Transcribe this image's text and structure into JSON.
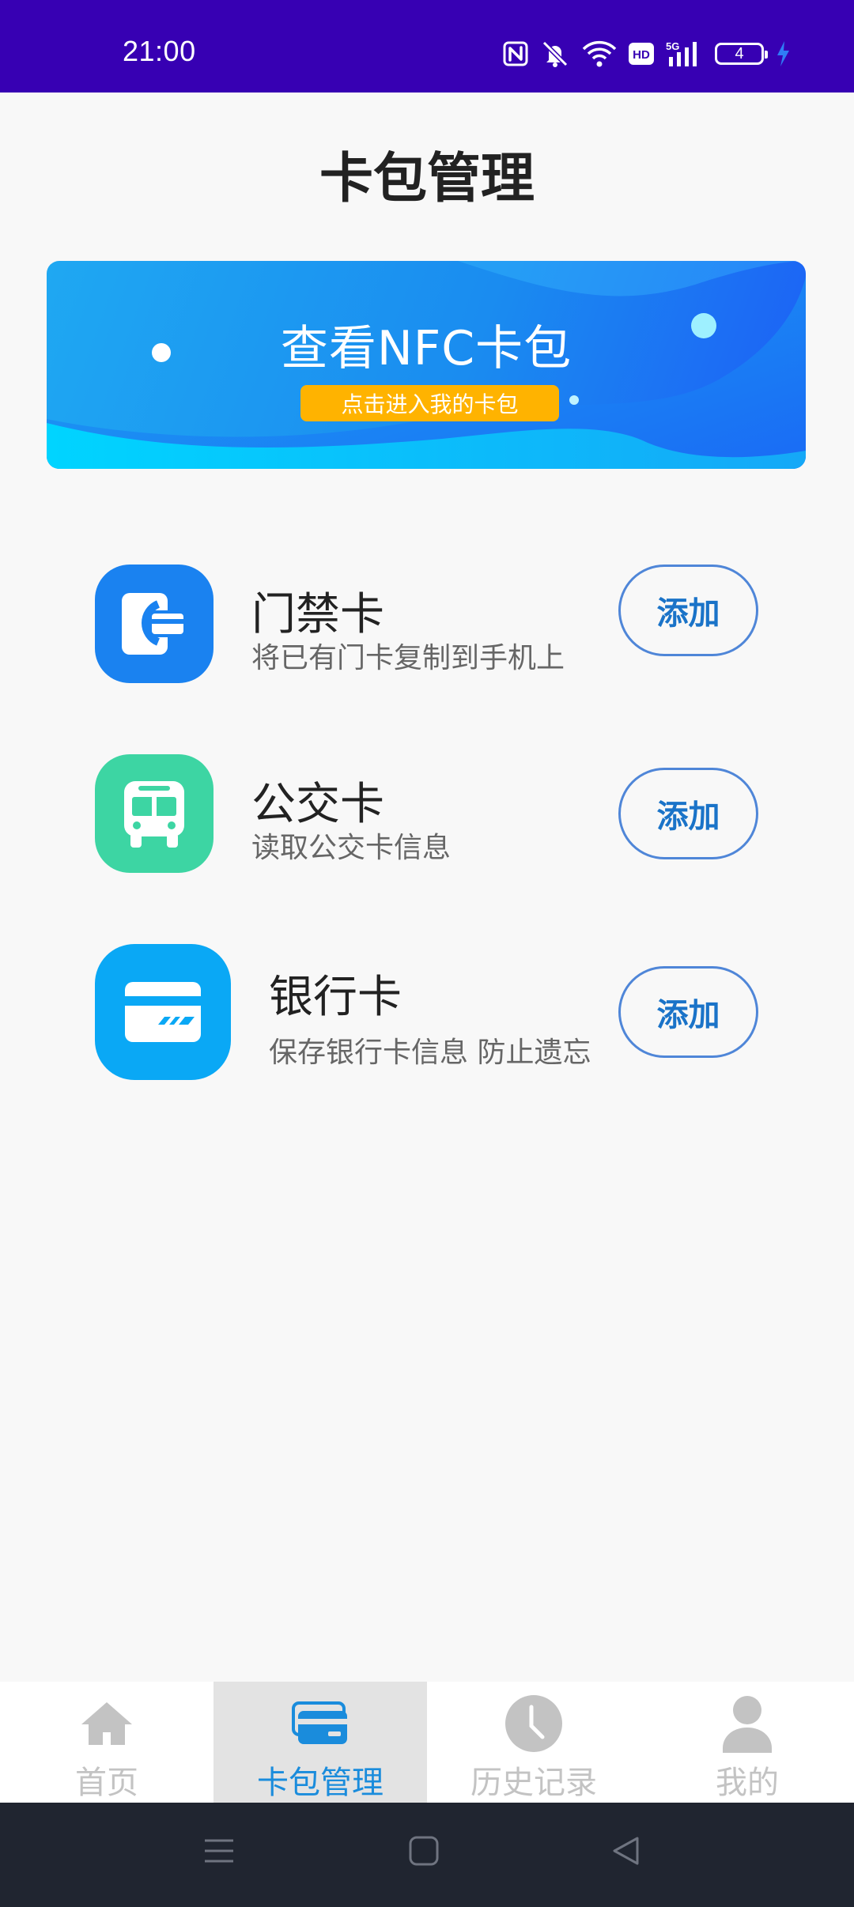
{
  "status_bar": {
    "time": "21:00",
    "battery_level": "4",
    "icons": [
      "nfc-icon",
      "mute-icon",
      "wifi-icon",
      "hd-icon",
      "signal-5g-icon",
      "battery-icon",
      "charging-icon"
    ]
  },
  "page": {
    "title": "卡包管理"
  },
  "banner": {
    "title": "查看NFC卡包",
    "button_label": "点击进入我的卡包"
  },
  "cards": [
    {
      "title": "门禁卡",
      "description": "将已有门卡复制到手机上",
      "action": "添加",
      "icon": "access-card-icon",
      "color": "#1a82f0"
    },
    {
      "title": "公交卡",
      "description": "读取公交卡信息",
      "action": "添加",
      "icon": "bus-icon",
      "color": "#3dd5a3"
    },
    {
      "title": "银行卡",
      "description": "保存银行卡信息 防止遗忘",
      "action": "添加",
      "icon": "bank-card-icon",
      "color": "#0aa8f5"
    }
  ],
  "bottom_nav": {
    "items": [
      {
        "label": "首页",
        "icon": "home-icon",
        "active": false
      },
      {
        "label": "卡包管理",
        "icon": "wallet-icon",
        "active": true
      },
      {
        "label": "历史记录",
        "icon": "clock-icon",
        "active": false
      },
      {
        "label": "我的",
        "icon": "user-icon",
        "active": false
      }
    ]
  },
  "colors": {
    "status_bar": "#3700b3",
    "accent": "#1a8cdc",
    "banner_button": "#ffb300"
  }
}
